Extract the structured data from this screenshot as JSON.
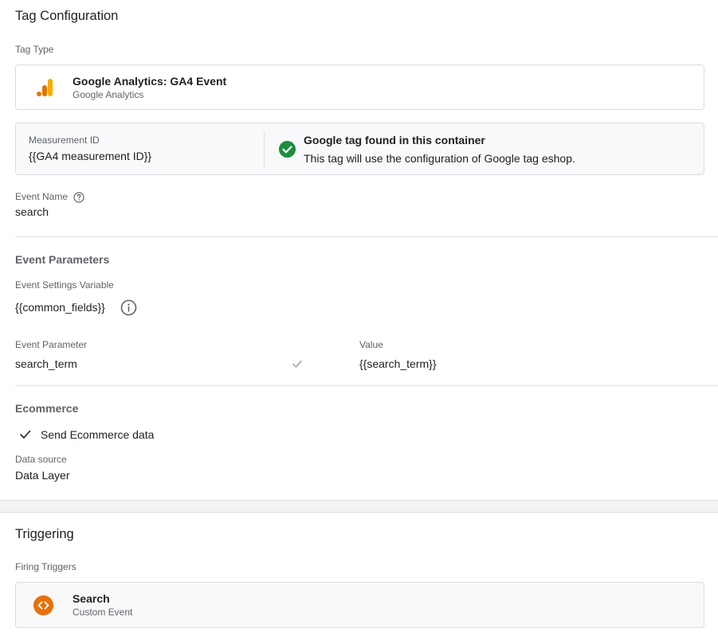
{
  "tag_config": {
    "title": "Tag Configuration",
    "tag_type_label": "Tag Type",
    "tag_type_name": "Google Analytics: GA4 Event",
    "tag_type_sub": "Google Analytics",
    "tag_type_icon": "google-analytics-icon",
    "measurement_id_label": "Measurement ID",
    "measurement_id_value": "{{GA4 measurement ID}}",
    "google_tag_status_title": "Google tag found in this container",
    "google_tag_status_desc": "This tag will use the configuration of Google tag eshop.",
    "status_icon": "check-circle-icon",
    "status_color": "#1e8e3e",
    "event_name_label": "Event Name",
    "event_name_value": "search",
    "event_params_title": "Event Parameters",
    "event_settings_label": "Event Settings Variable",
    "event_settings_value": "{{common_fields}}",
    "param_col_label": "Event Parameter",
    "value_col_label": "Value",
    "params": [
      {
        "name": "search_term",
        "value": "{{search_term}}"
      }
    ],
    "ecommerce_title": "Ecommerce",
    "send_ecommerce_label": "Send Ecommerce data",
    "data_source_label": "Data source",
    "data_source_value": "Data Layer"
  },
  "triggering": {
    "title": "Triggering",
    "firing_label": "Firing Triggers",
    "trigger_name": "Search",
    "trigger_type": "Custom Event",
    "trigger_icon": "custom-event-icon",
    "trigger_color": "#e8710a"
  }
}
